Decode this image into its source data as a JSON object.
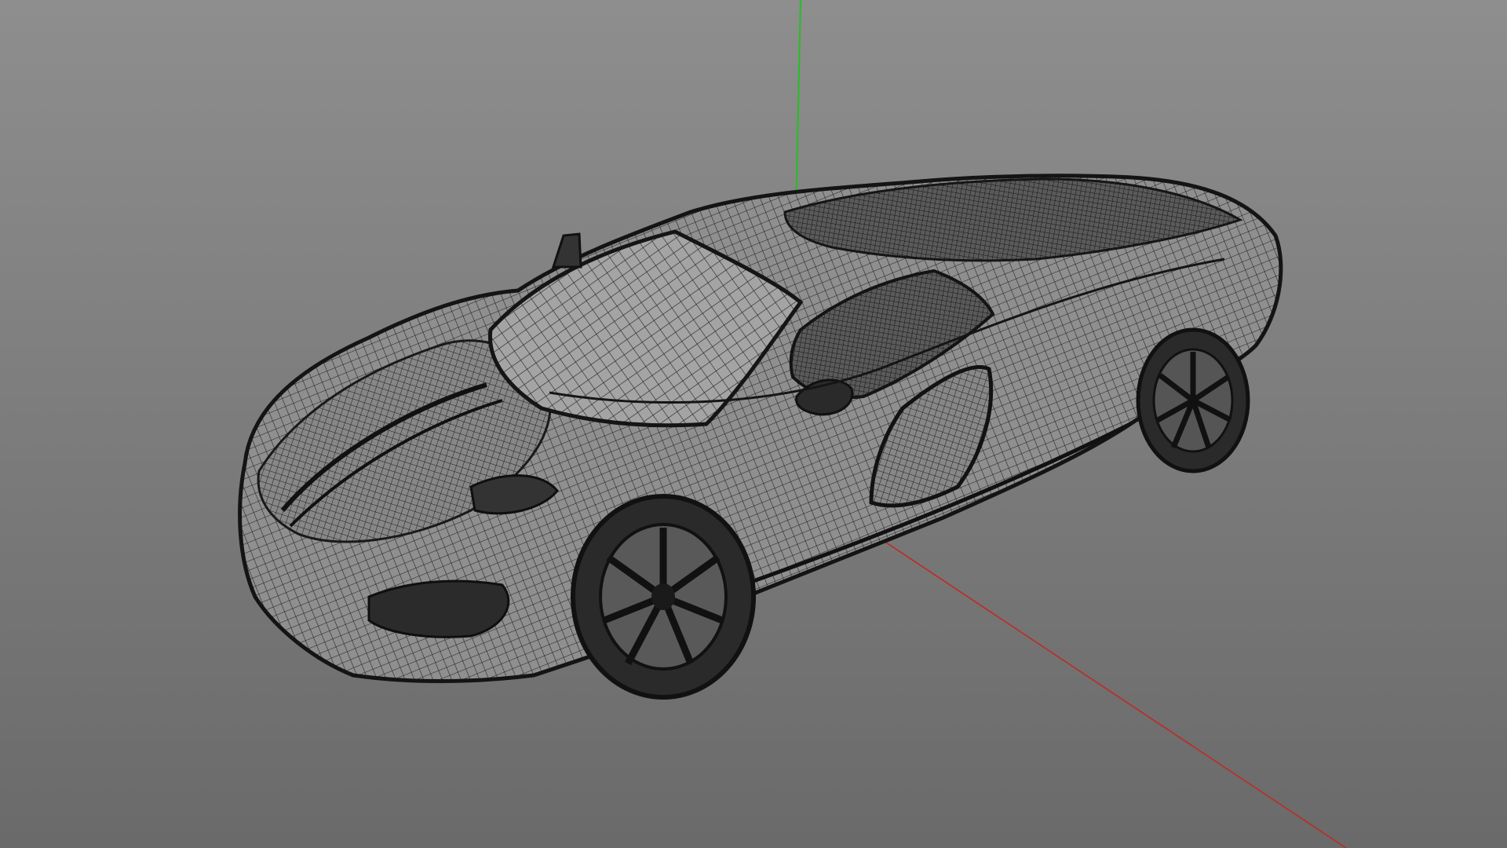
{
  "viewport": {
    "background_top": "#8e8e8e",
    "background_bottom": "#6a6a6a"
  },
  "axes": {
    "y_axis_color": "#22c022",
    "x_axis_color": "#c02a22"
  },
  "model": {
    "display_mode": "wireframe",
    "wire_color": "#1c1c1c",
    "icon": "sports-car-wireframe"
  }
}
